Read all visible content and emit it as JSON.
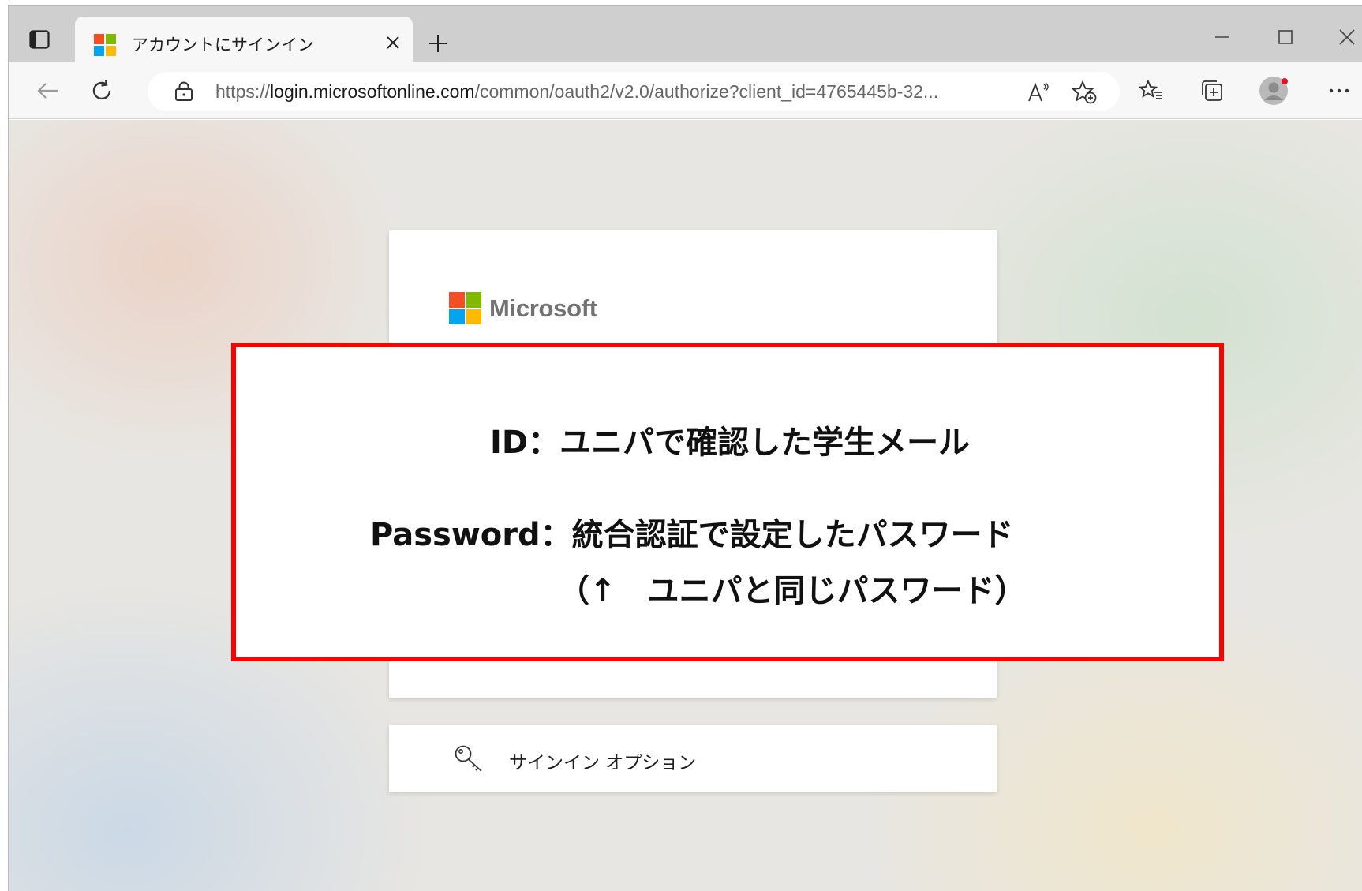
{
  "browser": {
    "tab": {
      "title": "アカウントにサインイン"
    },
    "new_tab_label": "+",
    "address": {
      "scheme": "https://",
      "host": "login.microsoftonline.com",
      "path": "/common/oauth2/v2.0/authorize?client_id=4765445b-32..."
    },
    "read_aloud_label": "A⁾"
  },
  "page": {
    "logo_text": "Microsoft",
    "logo_colors": [
      "#f25022",
      "#7fba00",
      "#00a4ef",
      "#ffb900"
    ],
    "signin_options_label": "サインイン オプション"
  },
  "annotation": {
    "border_color": "#ff0000",
    "id_line": "ID：ユニパで確認した学生メール",
    "password_line": "Password：統合認証で設定したパスワード",
    "note_line": "（↑　ユニパと同じパスワード）"
  }
}
